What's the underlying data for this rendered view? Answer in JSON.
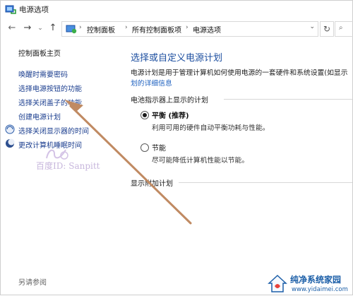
{
  "window": {
    "title": "电源选项"
  },
  "nav": {
    "back_icon": "←",
    "forward_icon": "→",
    "recent_icon": "⌄",
    "up_icon": "↑",
    "breadcrumbs": [
      "控制面板",
      "所有控制面板项",
      "电源选项"
    ],
    "refresh_icon": "↻",
    "search_icon": "⌕"
  },
  "sidebar": {
    "home": "控制面板主页",
    "items": [
      "唤醒时需要密码",
      "选择电源按钮的功能",
      "选择关闭盖子的功能",
      "创建电源计划",
      "选择关闭显示器的时间",
      "更改计算机睡眠时间"
    ],
    "see_also": "另请参阅"
  },
  "main": {
    "heading": "选择或自定义电源计划",
    "description": "电源计划是用于管理计算机如何使用电源的一套硬件和系统设置(如显示",
    "detail_link": "划的详细信息",
    "battery_section": "电池指示器上显示的计划",
    "plans": [
      {
        "name": "平衡 (推荐)",
        "desc": "利用可用的硬件自动平衡功耗与性能。",
        "selected": true
      },
      {
        "name": "节能",
        "desc": "尽可能降低计算机性能以节能。",
        "selected": false
      }
    ],
    "extra_section": "显示附加计划"
  },
  "watermark": {
    "text": "百度ID: Sanpitt"
  },
  "brand": {
    "name": "纯净系统家园",
    "url": "www.yidaimei.com"
  },
  "colors": {
    "link": "#1b3e8f",
    "heading": "#1d4fa0",
    "arrow": "#c08a62"
  }
}
